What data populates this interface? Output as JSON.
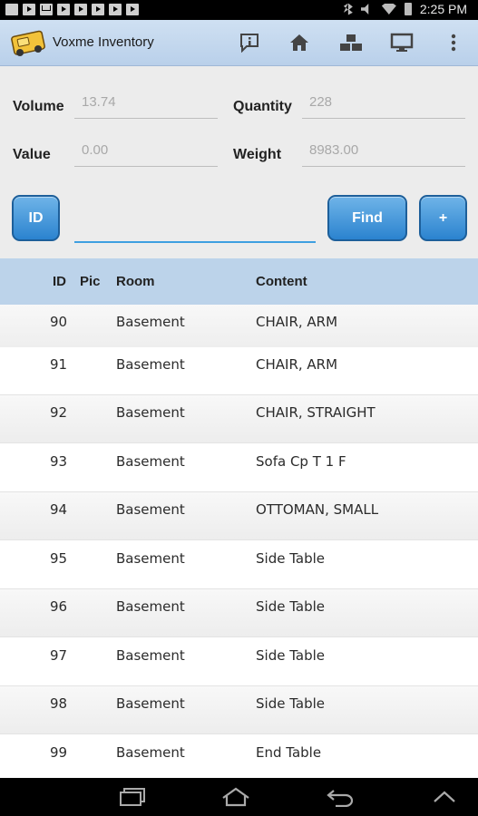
{
  "status_bar": {
    "time": "2:25 PM",
    "notification_icons": [
      "image-icon",
      "play-icon",
      "mail-icon",
      "play-icon",
      "play-icon",
      "play-icon",
      "play-icon",
      "play-icon"
    ],
    "system_icons": [
      "bluetooth-icon",
      "mute-icon",
      "wifi-icon",
      "battery-icon"
    ]
  },
  "action_bar": {
    "title": "Voxme Inventory",
    "actions": [
      "info-icon",
      "home-icon",
      "rooms-icon",
      "monitor-icon",
      "overflow-menu-icon"
    ]
  },
  "summary": {
    "volume_label": "Volume",
    "volume_value": "13.74",
    "quantity_label": "Quantity",
    "quantity_value": "228",
    "value_label": "Value",
    "value_value": "0.00",
    "weight_label": "Weight",
    "weight_value": "8983.00"
  },
  "search": {
    "id_button": "ID",
    "input_value": "",
    "find_button": "Find",
    "add_button": "+"
  },
  "table": {
    "headers": {
      "id": "ID",
      "pic": "Pic",
      "room": "Room",
      "content": "Content"
    },
    "rows": [
      {
        "id": "90",
        "room": "Basement",
        "content": "CHAIR, ARM"
      },
      {
        "id": "91",
        "room": "Basement",
        "content": "CHAIR, ARM"
      },
      {
        "id": "92",
        "room": "Basement",
        "content": "CHAIR, STRAIGHT"
      },
      {
        "id": "93",
        "room": "Basement",
        "content": "Sofa Cp T 1 F"
      },
      {
        "id": "94",
        "room": "Basement",
        "content": "OTTOMAN, SMALL"
      },
      {
        "id": "95",
        "room": "Basement",
        "content": "Side Table"
      },
      {
        "id": "96",
        "room": "Basement",
        "content": "Side Table"
      },
      {
        "id": "97",
        "room": "Basement",
        "content": "Side Table"
      },
      {
        "id": "98",
        "room": "Basement",
        "content": "Side Table"
      },
      {
        "id": "99",
        "room": "Basement",
        "content": "End Table"
      }
    ]
  },
  "nav_bar": {
    "buttons": [
      "recent-apps-icon",
      "home-nav-icon",
      "back-icon",
      "keyboard-hide-icon"
    ]
  },
  "colors": {
    "action_bar": "#c3d8ee",
    "table_header": "#bcd3ea",
    "button_blue": "#2b83cf",
    "input_underline": "#3f9fe0"
  }
}
